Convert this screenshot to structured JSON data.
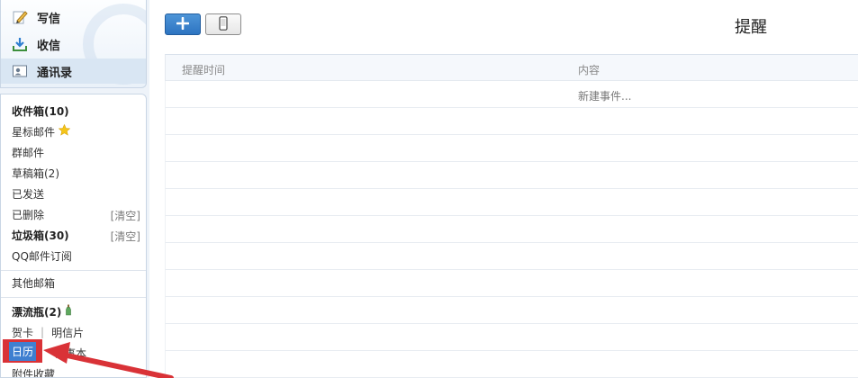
{
  "sidebar": {
    "top_items": [
      {
        "label": "写信",
        "icon": "pencil-icon"
      },
      {
        "label": "收信",
        "icon": "inbox-download-icon"
      },
      {
        "label": "通讯录",
        "icon": "contacts-card-icon"
      }
    ],
    "folders": {
      "inbox": "收件箱(10)",
      "starred": "星标邮件",
      "group": "群邮件",
      "drafts": "草稿箱(2)",
      "sent": "已发送",
      "deleted": "已删除",
      "deleted_clear": "[清空]",
      "spam": "垃圾箱(30)",
      "spam_clear": "[清空]",
      "subscriptions": "QQ邮件订阅",
      "other_mailbox": "其他邮箱",
      "drift_bottle": "漂流瓶(2)",
      "greeting_card": "贺卡",
      "postcard": "明信片",
      "calendar": "日历",
      "notes": "记事本",
      "attachments": "附件收藏"
    }
  },
  "toolbar": {
    "add_icon": "plus-icon",
    "mobile_icon": "mobile-phone-icon",
    "title": "提醒"
  },
  "table": {
    "headers": [
      "提醒时间",
      "内容"
    ],
    "rows": [
      [
        "",
        "新建事件..."
      ]
    ]
  },
  "colors": {
    "highlight_red": "#d93237",
    "accent_blue": "#3f7fd0"
  }
}
